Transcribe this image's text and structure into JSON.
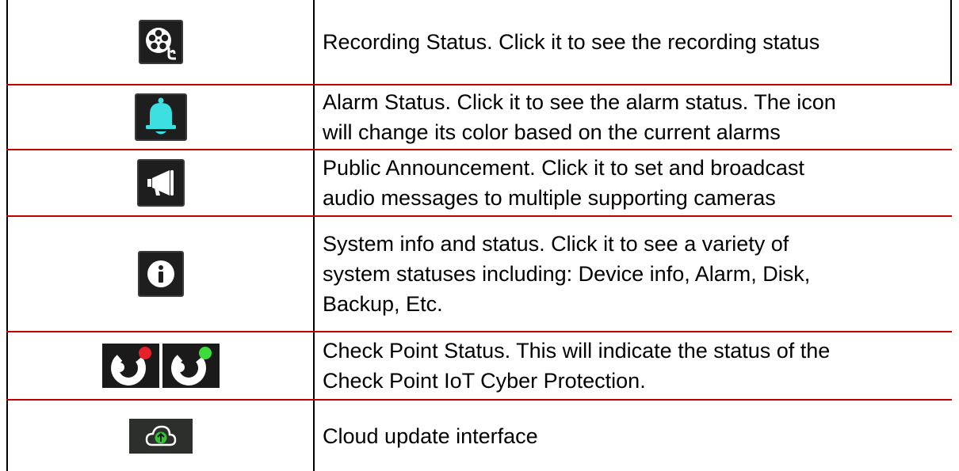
{
  "rows": [
    {
      "icon": "film-reel-icon",
      "lines": [
        "Recording Status. Click it to see the recording status"
      ]
    },
    {
      "icon": "bell-icon",
      "lines": [
        "Alarm Status. Click it to see the alarm status. The icon",
        "will change its color based on the current alarms"
      ]
    },
    {
      "icon": "megaphone-icon",
      "lines": [
        "Public Announcement. Click it to set and broadcast",
        "audio messages to multiple supporting cameras"
      ]
    },
    {
      "icon": "info-icon",
      "lines": [
        "System info and status. Click it to see a variety of",
        "system statuses including: Device info, Alarm, Disk,",
        "Backup, Etc."
      ]
    },
    {
      "icon": "check-point-status-icon",
      "lines": [
        "Check Point Status. This will indicate the status of the",
        "Check Point IoT Cyber Protection."
      ]
    },
    {
      "icon": "cloud-upload-icon",
      "lines": [
        "Cloud update interface"
      ]
    }
  ],
  "colors": {
    "border_red": "#c00000",
    "bell_accent": "#3de0e0",
    "status_red": "#e8202a",
    "status_green": "#3ddc3d",
    "upload_green": "#36c136"
  }
}
